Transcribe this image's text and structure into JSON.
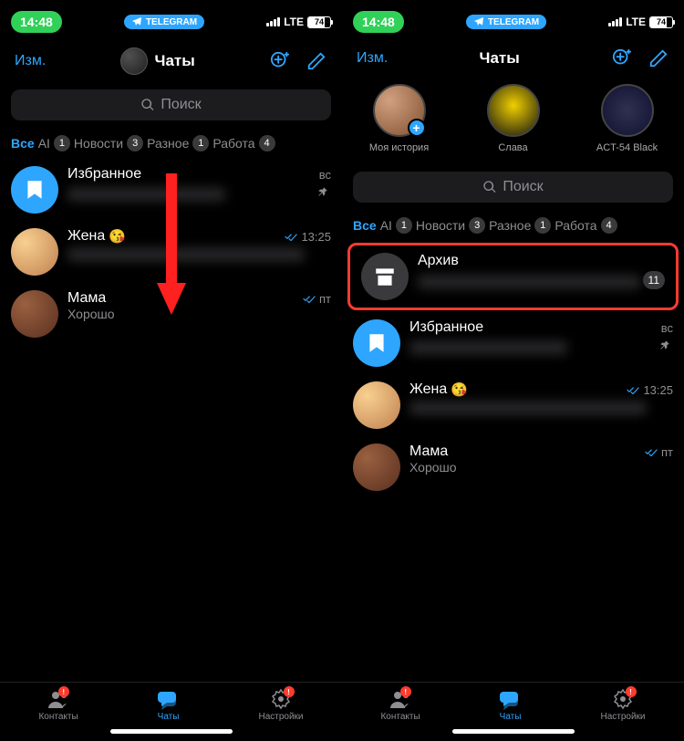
{
  "status": {
    "time": "14:48",
    "notif_app": "TELEGRAM",
    "network": "LTE",
    "battery": "74"
  },
  "header": {
    "edit": "Изм.",
    "title": "Чаты"
  },
  "search": {
    "placeholder": "Поиск"
  },
  "folders": [
    {
      "label": "Все",
      "active": true,
      "count": null
    },
    {
      "label": "AI",
      "count": "1"
    },
    {
      "label": "Новости",
      "count": "3"
    },
    {
      "label": "Разное",
      "count": "1"
    },
    {
      "label": "Работа",
      "count": "4"
    }
  ],
  "stories": [
    {
      "label": "Моя история",
      "has_add": true
    },
    {
      "label": "Слава"
    },
    {
      "label": "ACT-54 Black"
    }
  ],
  "chats_left": [
    {
      "name": "Избранное",
      "type": "saved",
      "pinned": true,
      "time": "вс"
    },
    {
      "name": "Жена",
      "emoji": "😘",
      "time": "13:25",
      "read": true
    },
    {
      "name": "Мама",
      "msg": "Хорошо",
      "time": "пт",
      "read": true
    }
  ],
  "chats_right": [
    {
      "name": "Архив",
      "type": "archive",
      "count": "11"
    },
    {
      "name": "Избранное",
      "type": "saved",
      "pinned": true,
      "time": "вс"
    },
    {
      "name": "Жена",
      "emoji": "😘",
      "time": "13:25",
      "read": true
    },
    {
      "name": "Мама",
      "msg": "Хорошо",
      "time": "пт",
      "read": true
    }
  ],
  "tabs": [
    {
      "label": "Контакты",
      "icon": "contacts",
      "notif": "!"
    },
    {
      "label": "Чаты",
      "icon": "chats",
      "active": true
    },
    {
      "label": "Настройки",
      "icon": "settings",
      "notif": "!"
    }
  ]
}
